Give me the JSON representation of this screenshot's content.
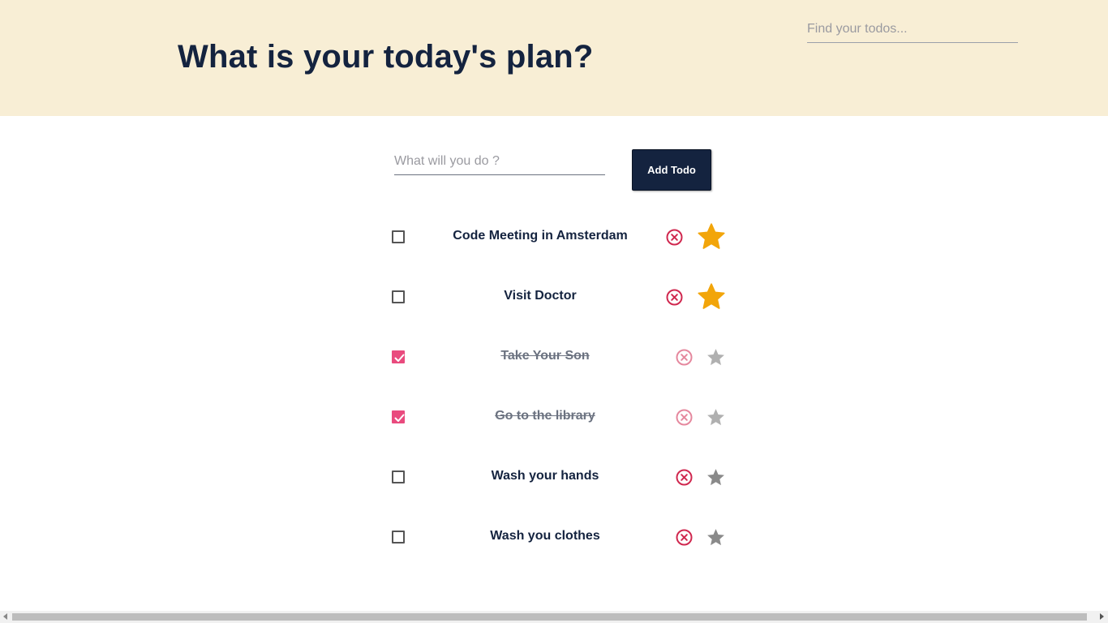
{
  "header": {
    "title": "What is your today's plan?",
    "search_placeholder": "Find your todos..."
  },
  "add_form": {
    "input_placeholder": "What will you do ?",
    "button_label": "Add Todo"
  },
  "todos": [
    {
      "text": "Code Meeting in Amsterdam",
      "done": false,
      "starred": true
    },
    {
      "text": "Visit Doctor",
      "done": false,
      "starred": true
    },
    {
      "text": "Take Your Son",
      "done": true,
      "starred": false
    },
    {
      "text": "Go to the library",
      "done": true,
      "starred": false
    },
    {
      "text": "Wash your hands",
      "done": false,
      "starred": false
    },
    {
      "text": "Wash you clothes",
      "done": false,
      "starred": false
    }
  ],
  "icons": {
    "delete": "close-circle-icon",
    "star": "star-icon",
    "check": "checkmark-icon"
  },
  "colors": {
    "header_bg": "#f8eed5",
    "primary": "#14233f",
    "accent_pink": "#e94b7e",
    "delete_red": "#d0284f",
    "star_active": "#f2a50a",
    "star_inactive": "#8a8a8a"
  }
}
